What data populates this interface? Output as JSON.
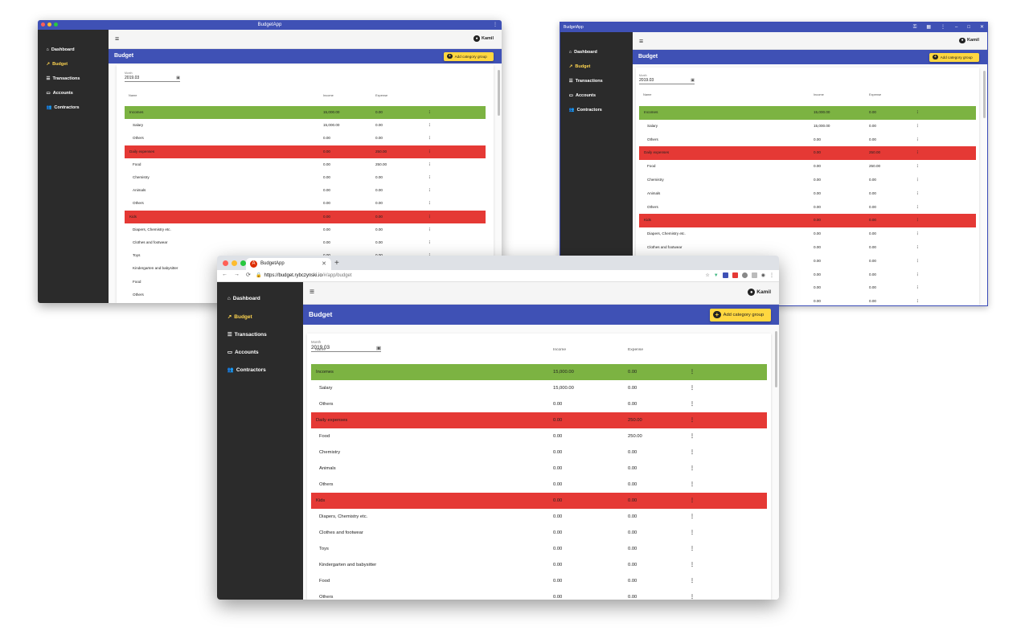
{
  "app": {
    "title": "BudgetApp",
    "nav": [
      {
        "label": "Dashboard",
        "icon": "home-icon"
      },
      {
        "label": "Budget",
        "icon": "trending-up-icon"
      },
      {
        "label": "Transactions",
        "icon": "list-icon"
      },
      {
        "label": "Accounts",
        "icon": "card-icon"
      },
      {
        "label": "Contractors",
        "icon": "people-icon"
      }
    ],
    "user": "Kamil",
    "page_title": "Budget",
    "add_button": "Add category group",
    "month_label": "Month",
    "month_value": "2019.03",
    "columns": {
      "name": "Name",
      "income": "Income",
      "expense": "Expense"
    },
    "rows": [
      {
        "name": "Incomes",
        "income": "15,000.00",
        "expense": "0.00",
        "type": "group-green"
      },
      {
        "name": "Salary",
        "income": "15,000.00",
        "expense": "0.00",
        "type": "item"
      },
      {
        "name": "Others",
        "income": "0.00",
        "expense": "0.00",
        "type": "item"
      },
      {
        "name": "Daily expenses",
        "income": "0.00",
        "expense": "250.00",
        "type": "group-red"
      },
      {
        "name": "Food",
        "income": "0.00",
        "expense": "250.00",
        "type": "item"
      },
      {
        "name": "Chemistry",
        "income": "0.00",
        "expense": "0.00",
        "type": "item"
      },
      {
        "name": "Animals",
        "income": "0.00",
        "expense": "0.00",
        "type": "item"
      },
      {
        "name": "Others",
        "income": "0.00",
        "expense": "0.00",
        "type": "item"
      },
      {
        "name": "Kids",
        "income": "0.00",
        "expense": "0.00",
        "type": "group-red"
      },
      {
        "name": "Diapers, Chemistry etc.",
        "income": "0.00",
        "expense": "0.00",
        "type": "item"
      },
      {
        "name": "Clothes and footwear",
        "income": "0.00",
        "expense": "0.00",
        "type": "item"
      },
      {
        "name": "Toys",
        "income": "0.00",
        "expense": "0.00",
        "type": "item"
      },
      {
        "name": "Kindergarten and babysitter",
        "income": "0.00",
        "expense": "0.00",
        "type": "item"
      },
      {
        "name": "Food",
        "income": "0.00",
        "expense": "0.00",
        "type": "item"
      },
      {
        "name": "Others",
        "income": "0.00",
        "expense": "0.00",
        "type": "item"
      }
    ]
  },
  "browser": {
    "tab_title": "BudgetApp",
    "url_host": "https://budget.rybczynski.io",
    "url_path": "/#/app/budget"
  },
  "colors": {
    "primary": "#3f51b5",
    "accent": "#ffd740",
    "sidebar": "#2b2b2b",
    "income_group": "#7cb342",
    "expense_group": "#e53935"
  }
}
